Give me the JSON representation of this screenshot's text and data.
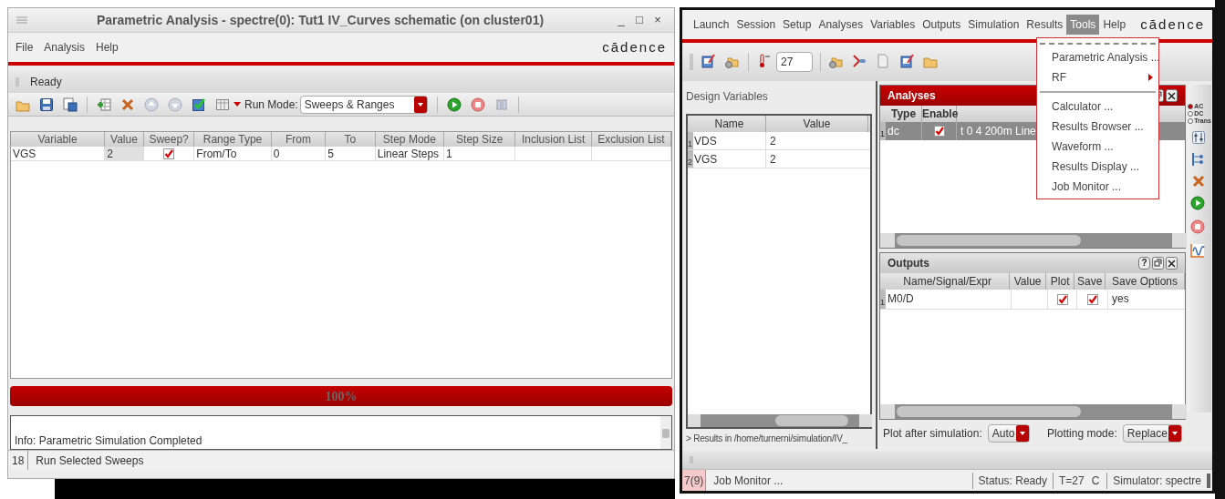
{
  "left_window": {
    "title": "Parametric Analysis - spectre(0): Tut1 IV_Curves schematic  (on cluster01)",
    "window_buttons": [
      "_",
      "□",
      "×"
    ],
    "menu": [
      "File",
      "Analysis",
      "Help"
    ],
    "logo": "cādence",
    "status": "Ready",
    "run_mode": {
      "label": "Run Mode:",
      "value": "Sweeps & Ranges"
    },
    "table": {
      "columns": [
        "Variable",
        "Value",
        "Sweep?",
        "Range Type",
        "From",
        "To",
        "Step Mode",
        "Step Size",
        "Inclusion List",
        "Exclusion List"
      ],
      "rows": [
        {
          "variable": "VGS",
          "value": "2",
          "sweep": true,
          "range_type": "From/To",
          "from": "0",
          "to": "5",
          "step_mode": "Linear Steps",
          "step_size": "1"
        }
      ]
    },
    "progress": {
      "level": 1,
      "label": "100%"
    },
    "log": [
      "Info: Parametric Simulation Completed"
    ],
    "status_bar": {
      "count": "18",
      "message": "Run Selected Sweeps"
    }
  },
  "right_window": {
    "menu": [
      {
        "label": "Launch",
        "selected": false
      },
      {
        "label": "Session",
        "selected": false
      },
      {
        "label": "Setup",
        "selected": false
      },
      {
        "label": "Analyses",
        "selected": false
      },
      {
        "label": "Variables",
        "selected": false
      },
      {
        "label": "Outputs",
        "selected": false
      },
      {
        "label": "Simulation",
        "selected": false
      },
      {
        "label": "Results",
        "selected": false
      },
      {
        "label": "Tools",
        "selected": true
      },
      {
        "label": "Help",
        "selected": false
      }
    ],
    "logo": "cādence",
    "temperature": "27",
    "design_variables": {
      "title": "Design Variables",
      "columns": [
        "Name",
        "Value"
      ],
      "rows": [
        {
          "index": "1",
          "name": "VDS",
          "value": "2"
        },
        {
          "index": "2",
          "name": "VGS",
          "value": "2"
        }
      ]
    },
    "results_path": "> Results in /home/turnerni/simulation/IV_",
    "analyses": {
      "title": "Analyses",
      "columns": [
        "Type",
        "Enable"
      ],
      "rows": [
        {
          "index": "1",
          "type": "dc",
          "enabled": true,
          "arguments": "t 0 4 200m Line"
        }
      ]
    },
    "outputs": {
      "title": "Outputs",
      "help": "?",
      "columns": [
        "Name/Signal/Expr",
        "Value",
        "Plot",
        "Save",
        "Save Options"
      ],
      "rows": [
        {
          "index": "1",
          "name": "M0/D",
          "plot": true,
          "save": true,
          "save_options": "yes"
        }
      ]
    },
    "plot_after": {
      "label": "Plot after simulation:",
      "value": "Auto"
    },
    "plotting_mode": {
      "label": "Plotting mode:",
      "value": "Replace"
    },
    "analysis_type": [
      {
        "label": "AC",
        "selected": true
      },
      {
        "label": "DC",
        "selected": false
      },
      {
        "label": "Trans",
        "selected": false
      }
    ],
    "status_bar": {
      "count": "7(9)",
      "message": "Job Monitor ...",
      "status": "Status: Ready",
      "temperature": "T=27",
      "unit": "C",
      "simulator": "Simulator: spectre"
    },
    "tools_menu": [
      {
        "kind": "tearoff"
      },
      {
        "kind": "item",
        "label": "Parametric Analysis ..."
      },
      {
        "kind": "submenu",
        "label": "RF"
      },
      {
        "kind": "separator"
      },
      {
        "kind": "item",
        "label": "Calculator ..."
      },
      {
        "kind": "item",
        "label": "Results Browser ..."
      },
      {
        "kind": "item",
        "label": "Waveform ..."
      },
      {
        "kind": "item",
        "label": "Results Display ..."
      },
      {
        "kind": "item",
        "label": "Job Monitor ..."
      }
    ]
  }
}
